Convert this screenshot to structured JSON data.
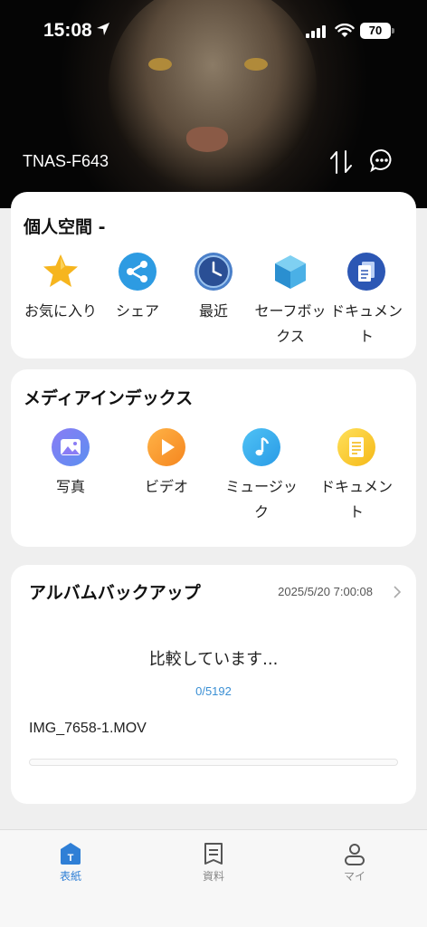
{
  "status_bar": {
    "time": "15:08",
    "battery": "70"
  },
  "header": {
    "device_name": "TNAS-F643"
  },
  "personal_space": {
    "title": "個人空間 -",
    "items": [
      {
        "label": "お気に入り",
        "icon": "star-icon"
      },
      {
        "label": "シェア",
        "icon": "share-icon"
      },
      {
        "label": "最近",
        "icon": "clock-icon"
      },
      {
        "label": "セーフボックス",
        "icon": "safebox-cube-icon"
      },
      {
        "label": "ドキュメント",
        "icon": "document-icon"
      }
    ]
  },
  "media_index": {
    "title": "メディアインデックス",
    "items": [
      {
        "label": "写真",
        "icon": "photo-icon"
      },
      {
        "label": "ビデオ",
        "icon": "video-play-icon"
      },
      {
        "label": "ミュージック",
        "icon": "music-note-icon"
      },
      {
        "label": "ドキュメント",
        "icon": "document-icon"
      }
    ]
  },
  "album_backup": {
    "title": "アルバムバックアップ",
    "date": "2025/5/20 7:00:08",
    "status": "比較しています...",
    "count": "0/5192",
    "progress": 0,
    "filename": "IMG_7658-1.MOV"
  },
  "tabbar": {
    "tabs": [
      {
        "label": "表紙",
        "active": true,
        "icon": "home-t-icon"
      },
      {
        "label": "資料",
        "active": false,
        "icon": "document-list-icon"
      },
      {
        "label": "マイ",
        "active": false,
        "icon": "user-icon"
      }
    ]
  },
  "colors": {
    "accent": "#2f7fd6",
    "count_text": "#3a8fd4"
  }
}
